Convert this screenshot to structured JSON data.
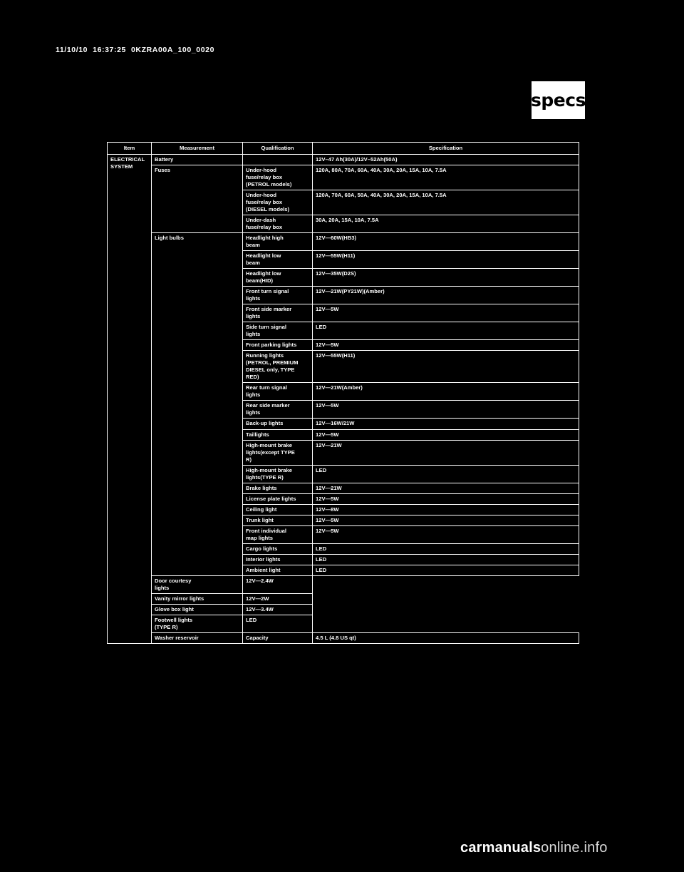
{
  "header": {
    "note": "11/10/10  16:37:25  0KZRA00A_100_0020"
  },
  "badge": {
    "label": "specs"
  },
  "watermark": {
    "bold": "carmanuals",
    "rest": "online.info"
  },
  "table": {
    "headers": [
      "Item",
      "Measurement",
      "Qualification",
      "Specification"
    ],
    "rows": [
      {
        "item": "ELECTRICAL\nSYSTEM",
        "item_rowspan": 32,
        "measurement": "Battery",
        "measurement_rowspan": 1,
        "qualification": "",
        "specification": "12V–47 Ah(30A)/12V–52Ah(50A)"
      },
      {
        "measurement": "Fuses",
        "measurement_rowspan": 3,
        "qualification": "Under-hood\nfuse/relay box\n(PETROL models)",
        "specification": "120A, 80A, 70A, 60A, 40A, 30A, 20A, 15A, 10A, 7.5A"
      },
      {
        "qualification": "Under-hood\nfuse/relay box\n(DIESEL models)",
        "specification": "120A, 70A, 60A, 50A, 40A, 30A, 20A, 15A, 10A, 7.5A"
      },
      {
        "qualification": "Under-dash\nfuse/relay box",
        "specification": "30A, 20A, 15A, 10A, 7.5A"
      },
      {
        "measurement": "Light bulbs",
        "measurement_rowspan": 22,
        "qualification": "Headlight high\nbeam",
        "specification": "12V—60W(HB3)"
      },
      {
        "qualification": "Headlight low\nbeam",
        "specification": "12V—55W(H11)"
      },
      {
        "qualification": "Headlight low\nbeam(HID)",
        "specification": "12V—35W(D2S)"
      },
      {
        "qualification": "Front turn signal\nlights",
        "specification": "12V—21W(PY21W)(Amber)"
      },
      {
        "qualification": "Front side marker\nlights",
        "specification": "12V—5W"
      },
      {
        "qualification": "Side turn signal\nlights",
        "specification": "LED"
      },
      {
        "qualification": "Front parking lights",
        "specification": "12V—5W"
      },
      {
        "qualification": "Running lights\n(PETROL, PREMIUM\nDIESEL only, TYPE\nRED)",
        "specification": "12V—55W(H11)"
      },
      {
        "qualification": "Rear turn signal\nlights",
        "specification": "12V—21W(Amber)"
      },
      {
        "qualification": "Rear side marker\nlights",
        "specification": "12V—5W"
      },
      {
        "qualification": "Back-up lights",
        "specification": "12V—16W/21W"
      },
      {
        "qualification": "Taillights",
        "specification": "12V—5W"
      },
      {
        "qualification": "High-mount brake\nlights(except TYPE\nR)",
        "specification": "12V—21W"
      },
      {
        "qualification": "High-mount brake\nlights(TYPE R)",
        "specification": "LED"
      },
      {
        "qualification": "Brake lights",
        "specification": "12V—21W"
      },
      {
        "qualification": "License plate lights",
        "specification": "12V—5W"
      },
      {
        "qualification": "Ceiling light",
        "specification": "12V—8W"
      },
      {
        "qualification": "Trunk light",
        "specification": "12V—5W"
      },
      {
        "qualification": "Front individual\nmap lights",
        "specification": "12V—5W"
      },
      {
        "qualification": "Cargo lights",
        "specification": "LED"
      },
      {
        "qualification": "Interior lights",
        "specification": "LED"
      },
      {
        "qualification": "Ambient light",
        "specification": "LED"
      },
      {
        "qualification": "Door courtesy\nlights",
        "specification": "12V—2.4W"
      },
      {
        "qualification": "Vanity mirror lights",
        "specification": "12V—2W"
      },
      {
        "qualification": "Glove box light",
        "specification": "12V—3.4W"
      },
      {
        "qualification": "Footwell lights\n(TYPE R)",
        "specification": "LED"
      },
      {
        "measurement": "Washer reservoir",
        "measurement_rowspan": 1,
        "qualification": "Capacity",
        "specification": "4.5 L (4.8 US qt)"
      }
    ]
  }
}
